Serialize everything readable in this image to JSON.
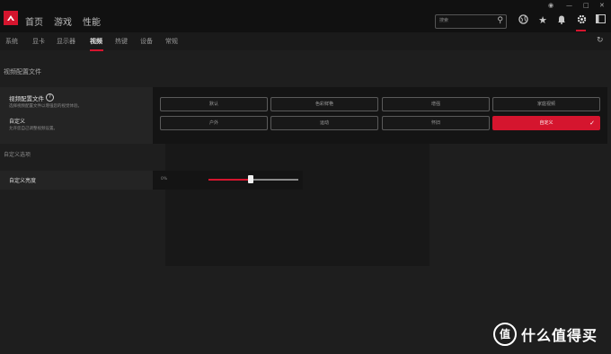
{
  "nav": {
    "home": "首页",
    "games": "游戏",
    "performance": "性能"
  },
  "search": {
    "placeholder": "搜索"
  },
  "tabs": [
    "系统",
    "显卡",
    "显示器",
    "视频",
    "热键",
    "设备",
    "常规"
  ],
  "sections": {
    "profile": "视频配置文件",
    "custom": "自定义选项"
  },
  "profile_panel": {
    "title": "视频配置文件",
    "desc": "选择视频配置文件以增强您的视觉体验。",
    "current": "自定义",
    "current_desc": "允许您自己调整视频设置。"
  },
  "profiles": [
    "默认",
    "色彩鲜艳",
    "增强",
    "家庭视频",
    "户外",
    "运动",
    "怀旧",
    "自定义"
  ],
  "selected_profile": "自定义",
  "brightness": {
    "label": "自定义亮度",
    "value": "0%",
    "level": 0.47
  },
  "watermark": {
    "icon": "值",
    "text": "什么值得买"
  },
  "colors": {
    "accent": "#d5152e"
  }
}
